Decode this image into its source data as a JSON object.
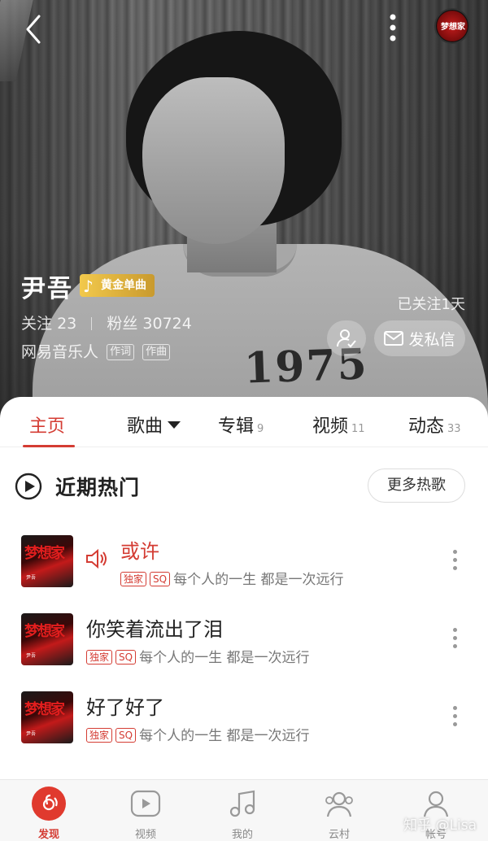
{
  "colors": {
    "accent": "#d43c33",
    "badge_gold": "#c99a2e"
  },
  "header": {
    "back_icon": "chevron-left-icon",
    "more_icon": "more-vertical-icon",
    "album_thumb_label": "梦想家"
  },
  "hero": {
    "shirt_print": "1975"
  },
  "artist": {
    "name": "尹吾",
    "badge": "黄金单曲",
    "follow_label": "关注",
    "follow_count": "23",
    "fans_label": "粉丝",
    "fans_count": "30724",
    "musician_label": "网易音乐人",
    "role_tags": [
      "作词",
      "作曲"
    ],
    "followed_days": "已关注1天",
    "message_button": "发私信"
  },
  "tabs": [
    {
      "label": "主页",
      "count": ""
    },
    {
      "label": "歌曲",
      "count": ""
    },
    {
      "label": "专辑",
      "count": "9"
    },
    {
      "label": "视频",
      "count": "11"
    },
    {
      "label": "动态",
      "count": "33"
    }
  ],
  "hot_section": {
    "title": "近期热门",
    "more_button": "更多热歌"
  },
  "songs": [
    {
      "title": "或许",
      "tag1": "独家",
      "tag2": "SQ",
      "album": "每个人的一生 都是一次远行",
      "playing": true
    },
    {
      "title": "你笑着流出了泪",
      "tag1": "独家",
      "tag2": "SQ",
      "album": "每个人的一生 都是一次远行",
      "playing": false
    },
    {
      "title": "好了好了",
      "tag1": "独家",
      "tag2": "SQ",
      "album": "每个人的一生 都是一次远行",
      "playing": false
    }
  ],
  "bottom_nav": [
    {
      "label": "发现",
      "icon": "netease-music-icon"
    },
    {
      "label": "视频",
      "icon": "video-play-icon"
    },
    {
      "label": "我的",
      "icon": "music-note-icon"
    },
    {
      "label": "云村",
      "icon": "community-icon"
    },
    {
      "label": "帐号",
      "icon": "account-icon"
    }
  ],
  "watermark": "知乎 @Lisa"
}
